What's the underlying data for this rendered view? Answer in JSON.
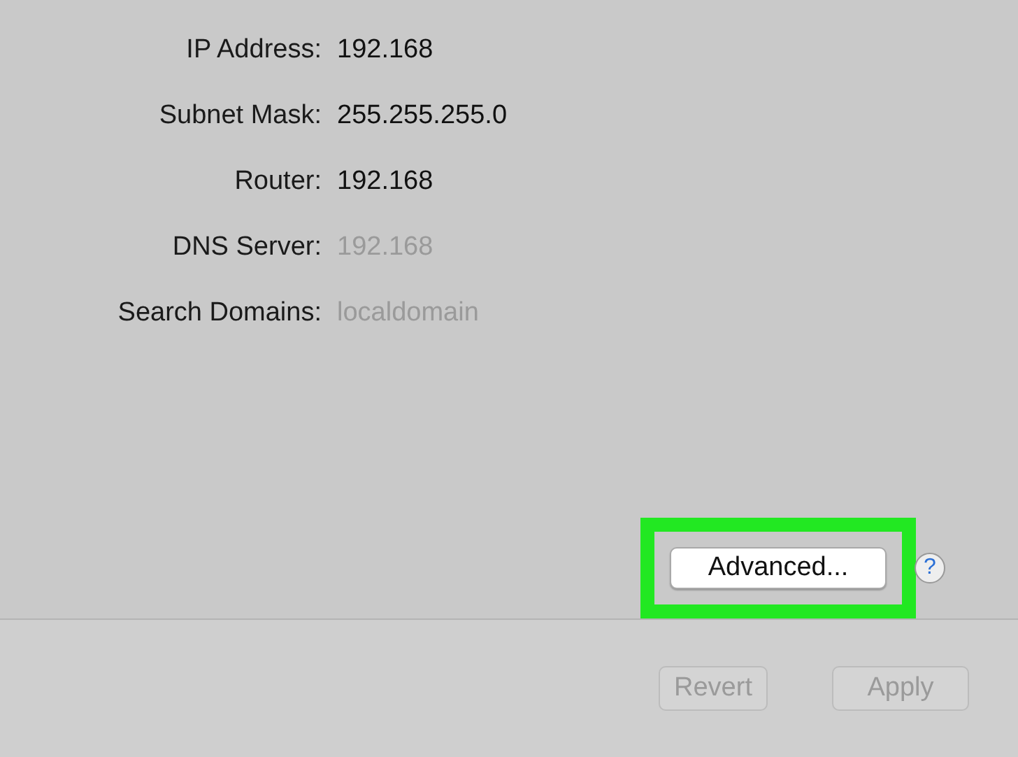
{
  "fields": [
    {
      "label": "IP Address:",
      "value": "192.168",
      "disabled": false
    },
    {
      "label": "Subnet Mask:",
      "value": "255.255.255.0",
      "disabled": false
    },
    {
      "label": "Router:",
      "value": "192.168",
      "disabled": false
    },
    {
      "label": "DNS Server:",
      "value": "192.168",
      "disabled": true
    },
    {
      "label": "Search Domains:",
      "value": "localdomain",
      "disabled": true
    }
  ],
  "advanced_button": {
    "label": "Advanced...",
    "highlighted": true
  },
  "help_button": {
    "label": "?"
  },
  "footer_buttons": [
    {
      "label": "Revert",
      "disabled": true
    },
    {
      "label": "Apply",
      "disabled": true
    }
  ]
}
